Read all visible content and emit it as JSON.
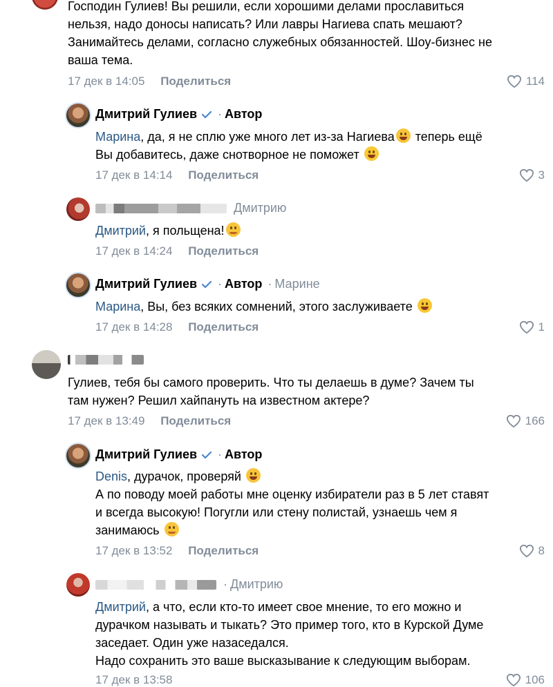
{
  "c0": {
    "lines": [
      "Господин Гулиев! Вы решили, если хорошими делами прославиться",
      "нельзя, надо доносы написать? Или лавры Нагиева спать мешают?",
      "Занимайтесь делами, согласно служебных обязанностей. Шоу-бизнес не",
      "ваша тема."
    ],
    "time": "17 дек в 14:05",
    "share": "Поделиться",
    "likes": "114"
  },
  "c1": {
    "author": "Дмитрий Гулиев",
    "badge": "Автор",
    "mention": "Марина",
    "line1": ", да, я не сплю уже много лет из-за Нагиева",
    "line1b": " теперь ещё",
    "line2": "Вы добавитесь, даже снотворное не поможет ",
    "time": "17 дек в 14:14",
    "share": "Поделиться",
    "likes": "3"
  },
  "c2": {
    "reply_to": "Дмитрию",
    "mention": "Дмитрий",
    "text": ", я польщена!",
    "time": "17 дек в 14:24",
    "share": "Поделиться"
  },
  "c3": {
    "author": "Дмитрий Гулиев",
    "badge": "Автор",
    "reply_to": "Марине",
    "mention": "Марина",
    "text": ", Вы, без всяких сомнений, этого заслуживаете ",
    "time": "17 дек в 14:28",
    "share": "Поделиться",
    "likes": "1"
  },
  "c4": {
    "lines": [
      "Гулиев, тебя бы самого проверить. Что ты делаешь в думе? Зачем ты",
      "там нужен? Решил хайпануть на известном актере?"
    ],
    "time": "17 дек в 13:49",
    "share": "Поделиться",
    "likes": "166"
  },
  "c5": {
    "author": "Дмитрий Гулиев",
    "badge": "Автор",
    "mention": "Denis",
    "line1": ", дурачок, проверяй ",
    "line2": "А по поводу моей работы мне оценку избиратели раз в 5 лет ставят",
    "line3": "и всегда высокую! Погугли или стену полистай, узнаешь чем я",
    "line4": "занимаюсь ",
    "time": "17 дек в 13:52",
    "share": "Поделиться",
    "likes": "8"
  },
  "c6": {
    "reply_to": "Дмитрию",
    "mention": "Дмитрий",
    "line1": ", а что, если кто-то имеет свое мнение, то его можно и",
    "line2": "дурачком называть и тыкать? Это пример того, кто в Курской Думе",
    "line3": "заседает. Один уже назаседался.",
    "line4": "Надо сохранить это ваше высказывание к следующим выборам.",
    "time": "17 дек в 13:58",
    "likes": "106"
  },
  "colors": {
    "link": "#2a5885",
    "meta": "#818c99",
    "verified": "#4986cc"
  },
  "icons": [
    "heart-icon",
    "verified-icon",
    "grin-emoji",
    "joy-emoji",
    "smile-emoji",
    "wink-emoji"
  ]
}
